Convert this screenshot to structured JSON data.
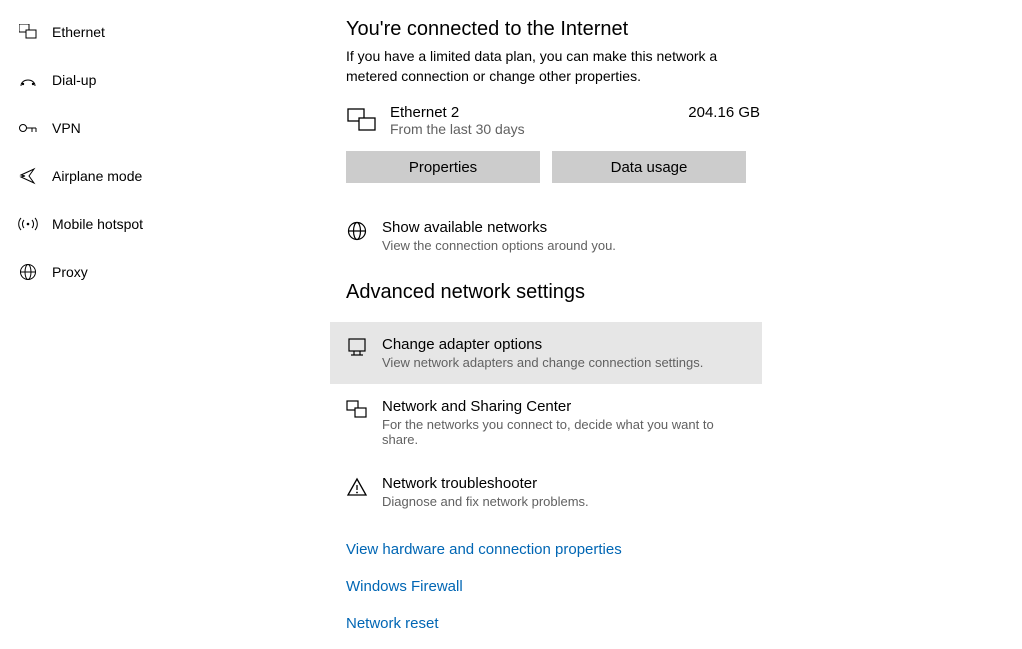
{
  "sidebar": {
    "items": [
      {
        "label": "Ethernet",
        "icon": "ethernet-icon"
      },
      {
        "label": "Dial-up",
        "icon": "dialup-icon"
      },
      {
        "label": "VPN",
        "icon": "vpn-icon"
      },
      {
        "label": "Airplane mode",
        "icon": "airplane-icon"
      },
      {
        "label": "Mobile hotspot",
        "icon": "hotspot-icon"
      },
      {
        "label": "Proxy",
        "icon": "proxy-icon"
      }
    ]
  },
  "main": {
    "status_title": "You're connected to the Internet",
    "status_sub": "If you have a limited data plan, you can make this network a metered connection or change other properties.",
    "connection": {
      "name": "Ethernet 2",
      "sub": "From the last 30 days",
      "usage": "204.16 GB"
    },
    "btn_properties": "Properties",
    "btn_data_usage": "Data usage",
    "show_networks": {
      "title": "Show available networks",
      "sub": "View the connection options around you."
    },
    "section_title": "Advanced network settings",
    "adv": [
      {
        "title": "Change adapter options",
        "sub": "View network adapters and change connection settings."
      },
      {
        "title": "Network and Sharing Center",
        "sub": "For the networks you connect to, decide what you want to share."
      },
      {
        "title": "Network troubleshooter",
        "sub": "Diagnose and fix network problems."
      }
    ],
    "links": [
      "View hardware and connection properties",
      "Windows Firewall",
      "Network reset"
    ]
  }
}
